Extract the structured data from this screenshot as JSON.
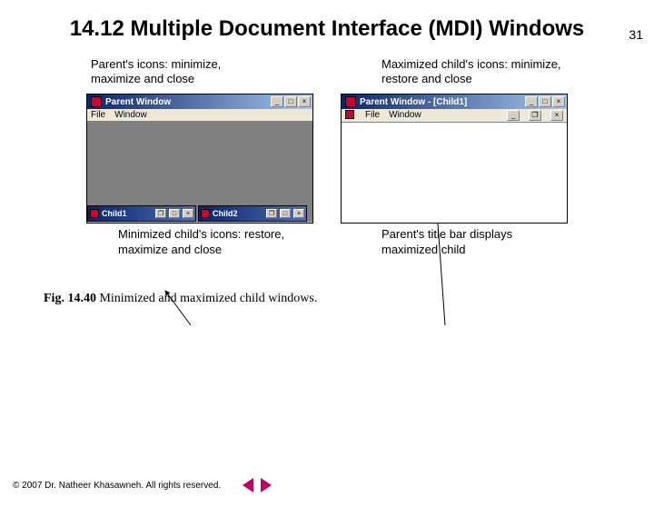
{
  "page_number": "31",
  "heading": "14.12  Multiple Document Interface (MDI) Windows",
  "labels": {
    "top_left": "Parent's icons: minimize, maximize and close",
    "top_right": "Maximized child's icons: minimize, restore and close",
    "bottom_left": "Minimized child's icons: restore, maximize and close",
    "bottom_right": "Parent's title bar displays maximized child"
  },
  "window_left": {
    "title": "Parent Window",
    "buttons": {
      "min": "_",
      "max": "□",
      "close": "×"
    },
    "menus": {
      "file": "File",
      "window": "Window"
    },
    "minimized_children": [
      {
        "title": "Child1",
        "btn_restore": "❐",
        "btn_max": "□",
        "btn_close": "×"
      },
      {
        "title": "Child2",
        "btn_restore": "❐",
        "btn_max": "□",
        "btn_close": "×"
      }
    ]
  },
  "window_right": {
    "title": "Parent Window - [Child1]",
    "buttons": {
      "min": "_",
      "max": "□",
      "close": "×"
    },
    "child_buttons": {
      "min": "_",
      "restore": "❐",
      "close": "×"
    },
    "menus": {
      "file": "File",
      "window": "Window"
    }
  },
  "caption": {
    "label": "Fig. 14.40",
    "text": "  Minimized and maximized child windows."
  },
  "footer": {
    "copyright": "© 2007 Dr. Natheer Khasawneh.  All rights reserved."
  }
}
